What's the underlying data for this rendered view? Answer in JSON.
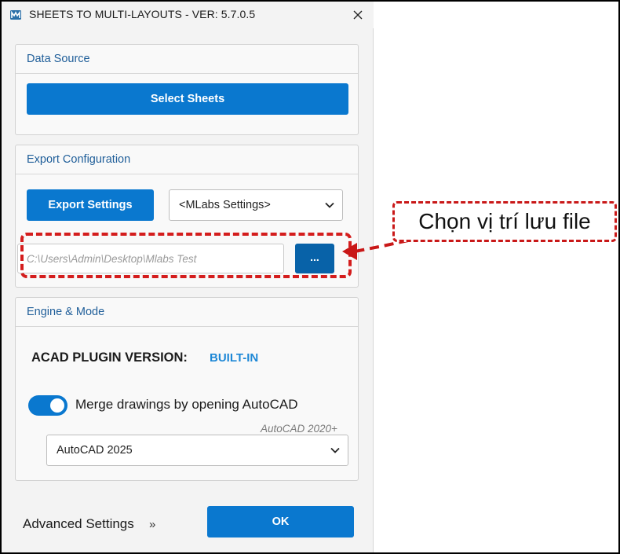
{
  "window": {
    "title": "SHEETS TO MULTI-LAYOUTS - VER: 5.7.0.5"
  },
  "data_source": {
    "header": "Data Source",
    "select_sheets_label": "Select Sheets"
  },
  "export_configuration": {
    "header": "Export Configuration",
    "export_settings_label": "Export Settings",
    "settings_dropdown_value": "<MLabs Settings>",
    "output_path_placeholder": "C:\\Users\\Admin\\Desktop\\Mlabs Test",
    "browse_label": "..."
  },
  "engine_mode": {
    "header": "Engine & Mode",
    "plugin_version_label": "ACAD PLUGIN VERSION:",
    "plugin_version_value": "BUILT-IN",
    "merge_toggle_label": "Merge drawings by opening AutoCAD",
    "merge_toggle_on": true,
    "autocad_hint": "AutoCAD 2020+",
    "autocad_version_value": "AutoCAD 2025"
  },
  "footer": {
    "advanced_settings_label": "Advanced Settings",
    "advanced_chevron": "»",
    "ok_label": "OK"
  },
  "annotation": {
    "callout_text": "Chọn vị trí lưu file"
  },
  "colors": {
    "primary": "#0a78cf",
    "browse": "#0862a8",
    "annotation_red": "#d41d1d",
    "header_text": "#1f5e99",
    "built_in": "#1e88d6"
  },
  "icons": {
    "app": "app-logo-icon",
    "close": "close-icon",
    "dropdown": "chevron-down-icon"
  }
}
